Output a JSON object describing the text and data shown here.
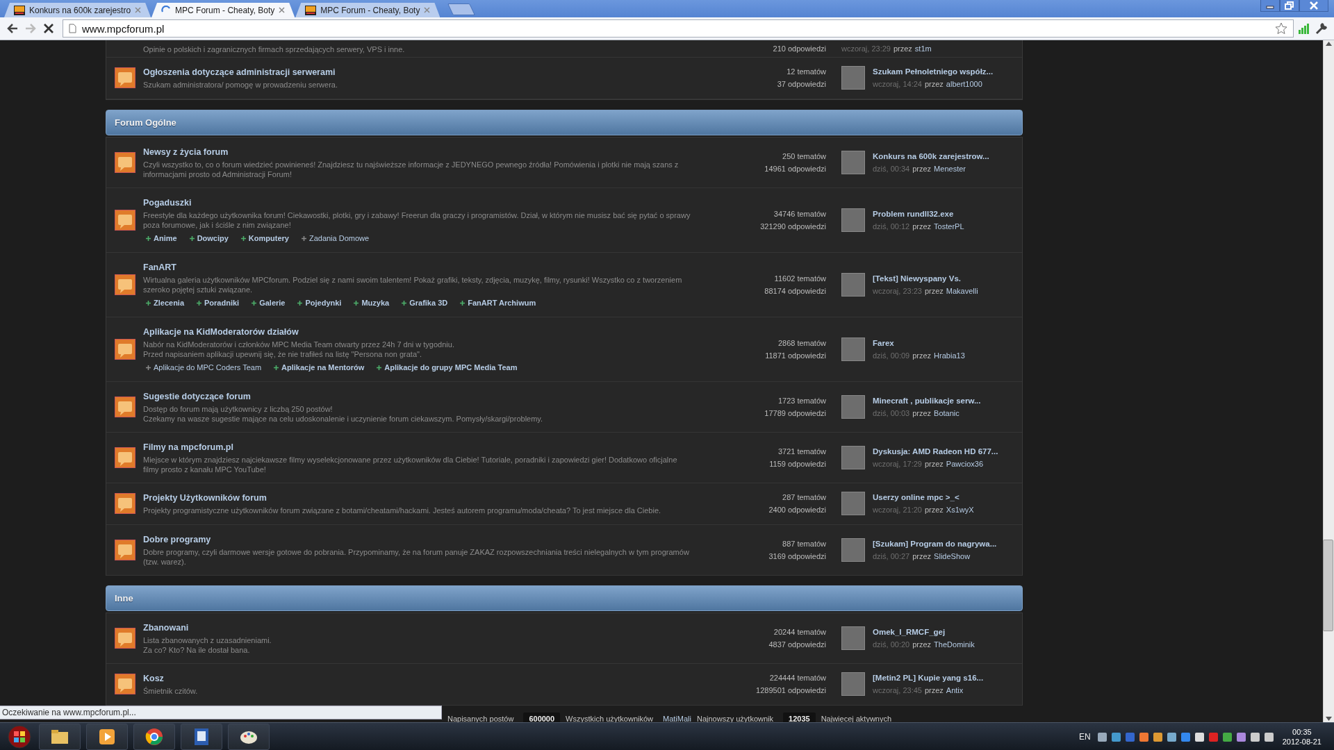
{
  "browser": {
    "tabs": [
      {
        "title": "Konkurs na 600k zarejestro",
        "selected": false,
        "loading": false
      },
      {
        "title": "MPC Forum - Cheaty, Boty",
        "selected": true,
        "loading": true
      },
      {
        "title": "MPC Forum - Cheaty, Boty",
        "selected": false,
        "loading": false
      }
    ],
    "address": "www.mpcforum.pl"
  },
  "forum": {
    "top_rows": [
      {
        "description": [
          "Opinie o polskich i zagranicznych firmach sprzedających serwery, VPS i inne."
        ],
        "replies": "210 odpowiedzi",
        "last_post": {
          "when": "wczoraj, 23:29",
          "by": "przez",
          "author": "st1m"
        }
      },
      {
        "title": "Ogłoszenia dotyczące administracji serwerami",
        "description": [
          "Szukam administratora/ pomogę w prowadzeniu serwera."
        ],
        "topics": "12 tematów",
        "replies": "37 odpowiedzi",
        "last_post": {
          "title": "Szukam Pełnoletniego współz...",
          "when": "wczoraj, 14:24",
          "by": "przez",
          "author": "albert1000"
        }
      }
    ],
    "categories": [
      {
        "title": "Forum Ogólne",
        "forums": [
          {
            "title": "Newsy z życia forum",
            "description": [
              "Czyli wszystko to, co o forum wiedzieć powinieneś! Znajdziesz tu najświeższe informacje z JEDYNEGO pewnego źródła! Pomówienia i plotki nie mają szans z informacjami prosto od Administracji Forum!"
            ],
            "topics": "250 tematów",
            "replies": "14961 odpowiedzi",
            "last_post": {
              "title": "Konkurs na 600k zarejestrow...",
              "when": "dziś, 00:34",
              "by": "przez",
              "author": "Menester"
            }
          },
          {
            "title": "Pogaduszki",
            "description": [
              "Freestyle dla każdego użytkownika forum! Ciekawostki, plotki, gry i zabawy! Freerun dla graczy i programistów. Dział, w którym nie musisz bać się pytać o sprawy poza forumowe, jak i ściśle z nim związane!"
            ],
            "subforums": [
              {
                "label": "Anime",
                "unread": true
              },
              {
                "label": "Dowcipy",
                "unread": true
              },
              {
                "label": "Komputery",
                "unread": true
              },
              {
                "label": "Zadania Domowe",
                "unread": false
              }
            ],
            "topics": "34746 tematów",
            "replies": "321290 odpowiedzi",
            "last_post": {
              "title": "Problem rundll32.exe",
              "when": "dziś, 00:12",
              "by": "przez",
              "author": "TosterPL"
            }
          },
          {
            "title": "FanART",
            "description": [
              "Wirtualna galeria użytkowników MPCforum. Podziel się z nami swoim talentem! Pokaż grafiki, teksty, zdjęcia, muzykę, filmy, rysunki! Wszystko co z tworzeniem szeroko pojętej sztuki związane."
            ],
            "subforums": [
              {
                "label": "Zlecenia",
                "unread": true
              },
              {
                "label": "Poradniki",
                "unread": true
              },
              {
                "label": "Galerie",
                "unread": true
              },
              {
                "label": "Pojedynki",
                "unread": true
              },
              {
                "label": "Muzyka",
                "unread": true
              },
              {
                "label": "Grafika 3D",
                "unread": true
              },
              {
                "label": "FanART Archiwum",
                "unread": true
              }
            ],
            "topics": "11602 tematów",
            "replies": "88174 odpowiedzi",
            "last_post": {
              "title": "[Tekst] Niewyspany Vs.",
              "when": "wczoraj, 23:23",
              "by": "przez",
              "author": "Makavelli"
            }
          },
          {
            "title": "Aplikacje na KidModeratorów działów",
            "description": [
              "Nabór na KidModeratorów i członków MPC Media Team otwarty przez 24h 7 dni w tygodniu.",
              "Przed napisaniem aplikacji upewnij się, że nie trafiłeś na listę \"Persona non grata\"."
            ],
            "subforums": [
              {
                "label": "Aplikacje do MPC Coders Team",
                "unread": false
              },
              {
                "label": "Aplikacje na Mentorów",
                "unread": true
              },
              {
                "label": "Aplikacje do grupy MPC Media Team",
                "unread": true
              }
            ],
            "topics": "2868 tematów",
            "replies": "11871 odpowiedzi",
            "last_post": {
              "title": "Farex",
              "when": "dziś, 00:09",
              "by": "przez",
              "author": "Hrabia13"
            }
          },
          {
            "title": "Sugestie dotyczące forum",
            "description": [
              "Dostęp do forum mają użytkownicy z liczbą 250 postów!",
              "Czekamy na wasze sugestie mające na celu udoskonalenie i uczynienie forum ciekawszym. Pomysły/skargi/problemy."
            ],
            "topics": "1723 tematów",
            "replies": "17789 odpowiedzi",
            "last_post": {
              "title": "Minecraft , publikacje serw...",
              "when": "dziś, 00:03",
              "by": "przez",
              "author": "Botanic"
            }
          },
          {
            "title": "Filmy na mpcforum.pl",
            "description": [
              "Miejsce w którym znajdziesz najciekawsze filmy wyselekcjonowane przez użytkowników dla Ciebie! Tutoriale, poradniki i zapowiedzi gier! Dodatkowo oficjalne filmy prosto z kanału MPC YouTube!"
            ],
            "topics": "3721 tematów",
            "replies": "1159 odpowiedzi",
            "last_post": {
              "title": "Dyskusja: AMD Radeon HD 677...",
              "when": "wczoraj, 17:29",
              "by": "przez",
              "author": "Pawciox36"
            }
          },
          {
            "title": "Projekty Użytkowników forum",
            "description": [
              "Projekty programistyczne użytkowników forum związane z botami/cheatami/hackami. Jesteś autorem programu/moda/cheata? To jest miejsce dla Ciebie."
            ],
            "topics": "287 tematów",
            "replies": "2400 odpowiedzi",
            "last_post": {
              "title": "Userzy online mpc >_<",
              "when": "wczoraj, 21:20",
              "by": "przez",
              "author": "Xs1wyX"
            }
          },
          {
            "title": "Dobre programy",
            "description": [
              "Dobre programy, czyli darmowe wersje gotowe do pobrania. Przypominamy, że na forum panuje ZAKAZ rozpowszechniania treści nielegalnych w tym programów (tzw. warez)."
            ],
            "topics": "887 tematów",
            "replies": "3169 odpowiedzi",
            "last_post": {
              "title": "[Szukam] Program do nagrywa...",
              "when": "dziś, 00:27",
              "by": "przez",
              "author": "SlideShow"
            }
          }
        ]
      },
      {
        "title": "Inne",
        "forums": [
          {
            "title": "Zbanowani",
            "description": [
              "Lista zbanowanych z uzasadnieniami.",
              "Za co? Kto? Na ile dostał bana."
            ],
            "topics": "20244 tematów",
            "replies": "4837 odpowiedzi",
            "last_post": {
              "title": "Omek_I_RMCF_gej",
              "when": "dziś, 00:20",
              "by": "przez",
              "author": "TheDominik"
            }
          },
          {
            "title": "Kosz",
            "description": [
              "Śmietnik czitów."
            ],
            "topics": "224444 tematów",
            "replies": "1289501 odpowiedzi",
            "last_post": {
              "title": "[Metin2 PL] Kupie yang s16...",
              "when": "wczoraj, 23:45",
              "by": "przez",
              "author": "Antix"
            }
          }
        ]
      }
    ]
  },
  "stats": [
    {
      "label": "Napisanych postów"
    },
    {
      "value": "600000",
      "label": "Wszystkich użytkowników"
    },
    {
      "user": "MatiMali",
      "label": "Najnowszy użytkownik"
    },
    {
      "value": "12035",
      "label": "Najwięcej aktywnych"
    }
  ],
  "status_text": "Oczekiwanie na www.mpcforum.pl...",
  "taskbar": {
    "language": "EN",
    "time": "00:35",
    "date": "2012-08-21"
  }
}
